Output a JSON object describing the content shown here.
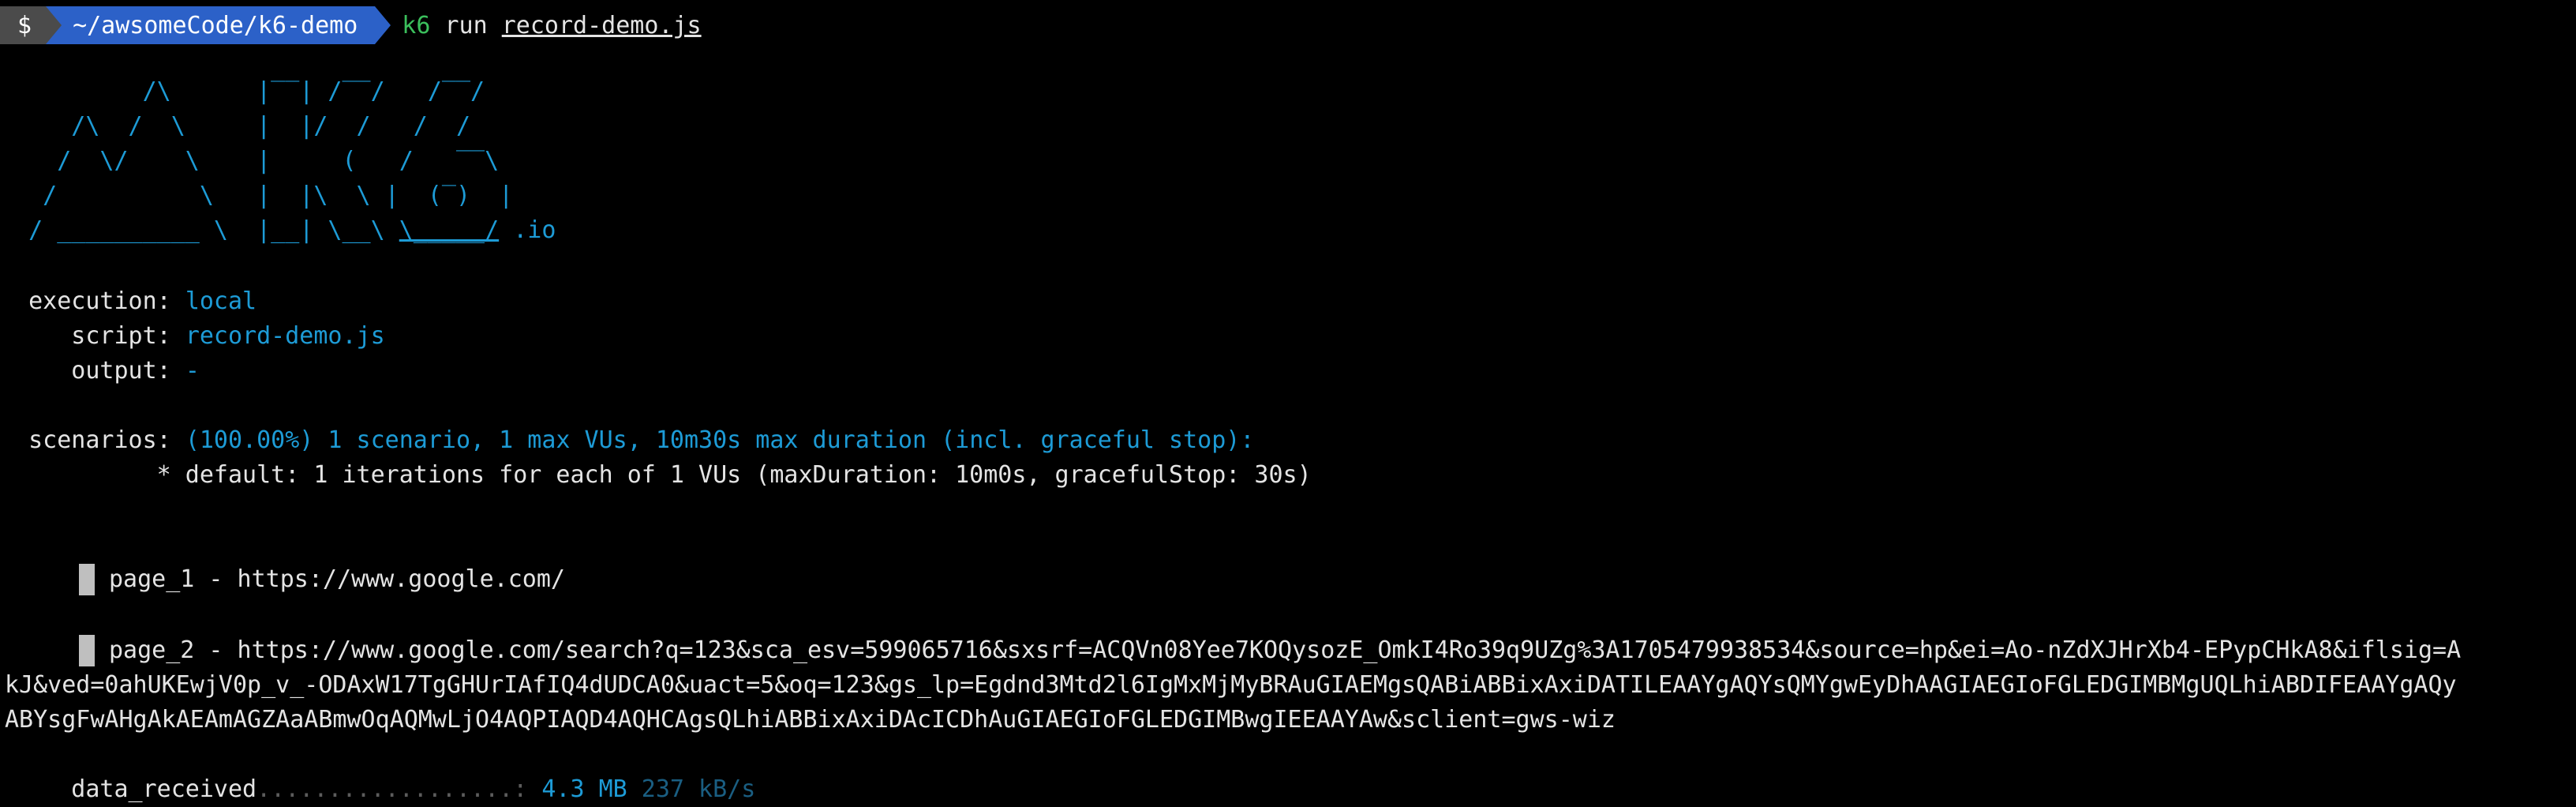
{
  "prompt": {
    "symbol": "$",
    "path": "~/awsomeCode/k6-demo",
    "command": "k6",
    "subcommand": "run",
    "script_arg": "record-demo.js"
  },
  "logo": {
    "lines": [
      "          /\\      |‾‾| /‾‾/   /‾‾/",
      "     /\\  /  \\     |  |/  /   /  /",
      "    /  \\/    \\    |     (   /   ‾‾\\",
      "   /          \\   |  |\\  \\ |  (‾)  |",
      "  / __________ \\  |__| \\__\\ "
    ],
    "underlined_part": "\\_____/",
    "suffix": " .io"
  },
  "execution": {
    "label": "  execution: ",
    "value": "local",
    "script_label": "     script: ",
    "script_value": "record-demo.js",
    "output_label": "     output: ",
    "output_value": "-"
  },
  "scenarios": {
    "label": "  scenarios: ",
    "summary": "(100.00%) 1 scenario, 1 max VUs, 10m30s max duration (incl. graceful stop):",
    "detail": "           * default: 1 iterations for each of 1 VUs (maxDuration: 10m0s, gracefulStop: 30s)"
  },
  "pages": [
    {
      "text": "page_1 - https://www.google.com/"
    },
    {
      "text": "page_2 - https://www.google.com/search?q=123&sca_esv=599065716&sxsrf=ACQVn08Yee7KOQysozE_OmkI4Ro39q9UZg%3A1705479938534&source=hp&ei=Ao-nZdXJHrXb4-EPypCHkA8&iflsig=A"
    }
  ],
  "wrapped_lines": [
    "kJ&ved=0ahUKEwjV0p_v_-ODAxW17TgGHUrIAfIQ4dUDCA0&uact=5&oq=123&gs_lp=Egdnd3Mtd2l6IgMxMjMyBRAuGIAEMgsQABiABBixAxiDATILEAAYgAQYsQMYgwEyDhAAGIAEGIoFGLEDGIMBMgUQLhiABDIFEAAYgAQy",
    "ABYsgFwAHgAkAEAmAGZAaABmwOqAQMwLjO4AQPIAQD4AQHCAgsQLhiABBixAxiDAcICDhAuGIAEGIoFGLEDGIMBwgIEEAAYAw&sclient=gws-wiz"
  ],
  "metrics": {
    "name": "     data_received",
    "dots": "..................: ",
    "value": "4.3 MB",
    "rate": " 237 kB/s"
  }
}
